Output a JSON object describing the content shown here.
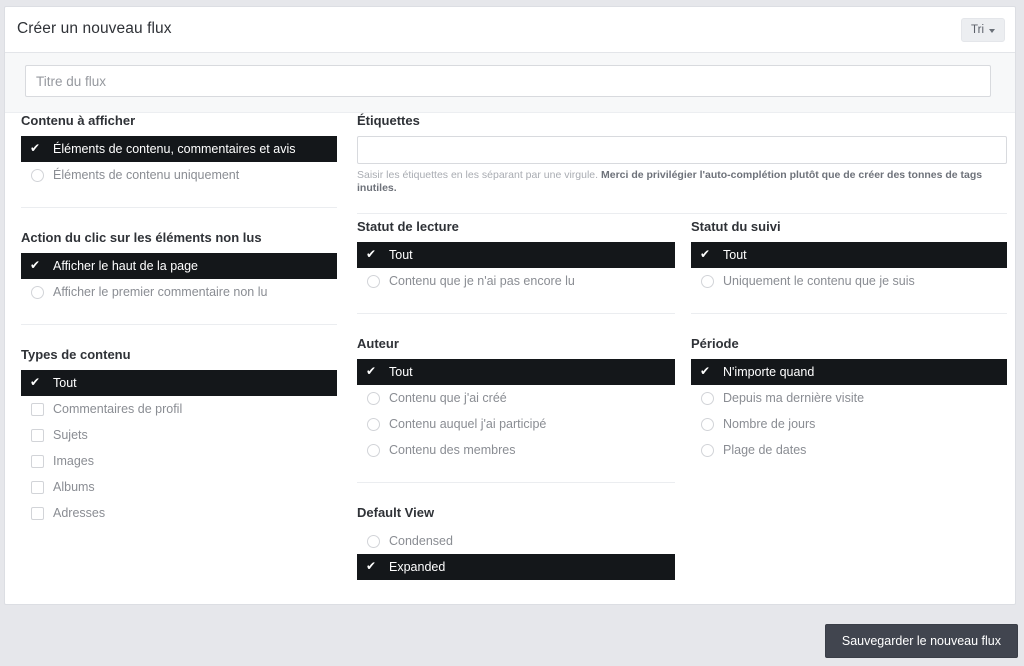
{
  "header": {
    "title": "Créer un nouveau flux",
    "sort_button_label": "Tri",
    "sort_icon": "chevron-down-icon"
  },
  "stream_title": {
    "placeholder": "Titre du flux",
    "value": ""
  },
  "left_column": {
    "content_to_display": {
      "title": "Contenu à afficher",
      "options": [
        {
          "label": "Éléments de contenu, commentaires et avis",
          "selected": true,
          "control": "radio"
        },
        {
          "label": "Éléments de contenu uniquement",
          "selected": false,
          "control": "radio"
        }
      ]
    },
    "click_action": {
      "title": "Action du clic sur les éléments non lus",
      "options": [
        {
          "label": "Afficher le haut de la page",
          "selected": true,
          "control": "radio"
        },
        {
          "label": "Afficher le premier commentaire non lu",
          "selected": false,
          "control": "radio"
        }
      ]
    },
    "content_types": {
      "title": "Types de contenu",
      "options": [
        {
          "label": "Tout",
          "selected": true,
          "control": "checkbox"
        },
        {
          "label": "Commentaires de profil",
          "selected": false,
          "control": "checkbox"
        },
        {
          "label": "Sujets",
          "selected": false,
          "control": "checkbox"
        },
        {
          "label": "Images",
          "selected": false,
          "control": "checkbox"
        },
        {
          "label": "Albums",
          "selected": false,
          "control": "checkbox"
        },
        {
          "label": "Adresses",
          "selected": false,
          "control": "checkbox"
        }
      ]
    }
  },
  "tags": {
    "title": "Étiquettes",
    "placeholder": "",
    "value": "",
    "help_plain": "Saisir les étiquettes en les séparant par une virgule. ",
    "help_bold": "Merci de privilégier l'auto-complétion plutôt que de créer des tonnes de tags inutiles."
  },
  "middle_column": {
    "read_status": {
      "title": "Statut de lecture",
      "options": [
        {
          "label": "Tout",
          "selected": true,
          "control": "radio"
        },
        {
          "label": "Contenu que je n'ai pas encore lu",
          "selected": false,
          "control": "radio"
        }
      ]
    },
    "author": {
      "title": "Auteur",
      "options": [
        {
          "label": "Tout",
          "selected": true,
          "control": "radio"
        },
        {
          "label": "Contenu que j'ai créé",
          "selected": false,
          "control": "radio"
        },
        {
          "label": "Contenu auquel j'ai participé",
          "selected": false,
          "control": "radio"
        },
        {
          "label": "Contenu des membres",
          "selected": false,
          "control": "radio"
        }
      ]
    },
    "default_view": {
      "title": "Default View",
      "options": [
        {
          "label": "Condensed",
          "selected": false,
          "control": "radio"
        },
        {
          "label": "Expanded",
          "selected": true,
          "control": "radio"
        }
      ]
    }
  },
  "right_column": {
    "follow_status": {
      "title": "Statut du suivi",
      "options": [
        {
          "label": "Tout",
          "selected": true,
          "control": "radio"
        },
        {
          "label": "Uniquement le contenu que je suis",
          "selected": false,
          "control": "radio"
        }
      ]
    },
    "period": {
      "title": "Période",
      "options": [
        {
          "label": "N'importe quand",
          "selected": true,
          "control": "radio"
        },
        {
          "label": "Depuis ma dernière visite",
          "selected": false,
          "control": "radio"
        },
        {
          "label": "Nombre de jours",
          "selected": false,
          "control": "radio"
        },
        {
          "label": "Plage de dates",
          "selected": false,
          "control": "radio"
        }
      ]
    }
  },
  "footer": {
    "save_label": "Sauvegarder le nouveau flux"
  },
  "colors": {
    "selected_bg": "#14171a",
    "page_bg": "#e6e7eb",
    "save_bg": "#41454f"
  }
}
